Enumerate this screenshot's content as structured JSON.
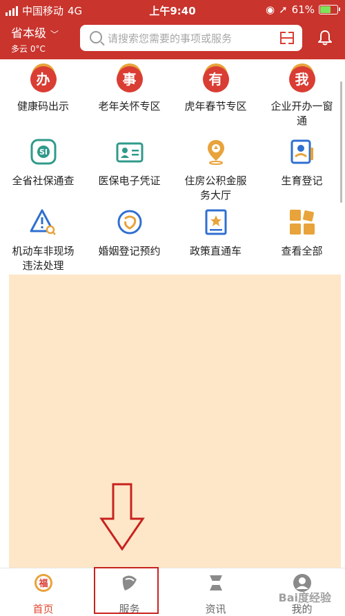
{
  "status_bar": {
    "carrier": "中国移动",
    "network": "4G",
    "time": "上午9:40",
    "battery": "61%",
    "battery_level": 0.61
  },
  "header": {
    "region": "省本级",
    "weather": "多云 0°C",
    "search_placeholder": "请搜索您需要的事项或服务"
  },
  "services": [
    {
      "label": "健康码出示",
      "icon": "ban-badge-icon",
      "badge": "办"
    },
    {
      "label": "老年关怀专区",
      "icon": "shi-badge-icon",
      "badge": "事"
    },
    {
      "label": "虎年春节专区",
      "icon": "you-badge-icon",
      "badge": "有"
    },
    {
      "label": "企业开办一窗通",
      "icon": "wo-badge-icon",
      "badge": "我"
    },
    {
      "label": "全省社保通查",
      "icon": "social-security-icon"
    },
    {
      "label": "医保电子凭证",
      "icon": "id-card-icon"
    },
    {
      "label": "住房公积金服务大厅",
      "icon": "location-pin-icon"
    },
    {
      "label": "生育登记",
      "icon": "registration-form-icon"
    },
    {
      "label": "机动车非现场违法处理",
      "icon": "warning-search-icon"
    },
    {
      "label": "婚姻登记预约",
      "icon": "marriage-icon"
    },
    {
      "label": "政策直通车",
      "icon": "policy-book-icon"
    },
    {
      "label": "查看全部",
      "icon": "grid-all-icon"
    }
  ],
  "tabs": [
    {
      "label": "首页",
      "icon": "home-fu-icon",
      "active": true
    },
    {
      "label": "服务",
      "icon": "service-icon",
      "active": false
    },
    {
      "label": "资讯",
      "icon": "news-icon",
      "active": false
    },
    {
      "label": "我的",
      "icon": "profile-icon",
      "active": false
    }
  ],
  "colors": {
    "brand_red": "#c9342d",
    "overlay": "#fde7c8",
    "accent_orange": "#e8a33a",
    "teal": "#2f9a8a",
    "blue": "#2f6fd0"
  },
  "watermark": "Bai度经验"
}
